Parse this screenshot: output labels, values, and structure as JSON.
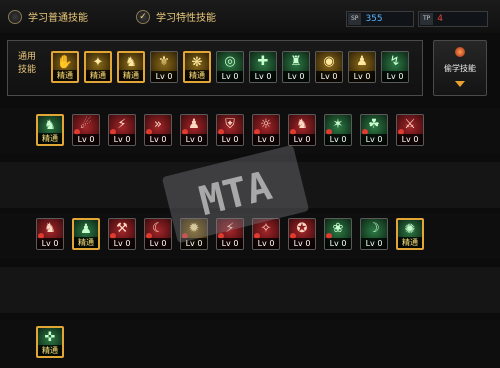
{
  "topbar": {
    "option_normal": "学习普通技能",
    "option_trait": "学习特性技能",
    "sp_label": "SP",
    "sp_value": "355",
    "tp_label": "TP",
    "tp_value": "4"
  },
  "common": {
    "label": "通用技能",
    "icons": [
      {
        "caption": "精通",
        "color": "gold",
        "hl": true,
        "glyph": "✋",
        "icon": "hand-icon"
      },
      {
        "caption": "精通",
        "color": "gold",
        "hl": true,
        "glyph": "✦",
        "icon": "swirl-icon"
      },
      {
        "caption": "精通",
        "color": "gold",
        "hl": true,
        "glyph": "♞",
        "icon": "figure-icon"
      },
      {
        "caption": "Lv 0",
        "color": "gold",
        "hl": false,
        "glyph": "⚜",
        "icon": "emblem-icon"
      },
      {
        "caption": "精通",
        "color": "gold",
        "hl": true,
        "glyph": "❋",
        "icon": "wing-icon"
      },
      {
        "caption": "Lv 0",
        "color": "green",
        "hl": false,
        "glyph": "◎",
        "icon": "target-icon"
      },
      {
        "caption": "Lv 0",
        "color": "green",
        "hl": false,
        "glyph": "✚",
        "icon": "cross-icon"
      },
      {
        "caption": "Lv 0",
        "color": "green",
        "hl": false,
        "glyph": "♜",
        "icon": "charge-icon"
      },
      {
        "caption": "Lv 0",
        "color": "gold",
        "hl": false,
        "glyph": "◉",
        "icon": "shield-icon"
      },
      {
        "caption": "Lv 0",
        "color": "gold",
        "hl": false,
        "glyph": "♟",
        "icon": "warrior-icon"
      },
      {
        "caption": "Lv 0",
        "color": "green",
        "hl": false,
        "glyph": "↯",
        "icon": "dash-icon"
      }
    ]
  },
  "steal_button": {
    "label": "偷学技能"
  },
  "row1": [
    {
      "caption": "精通",
      "color": "green",
      "hl": true,
      "glyph": "♞",
      "gem": false,
      "icon": "runner-icon"
    },
    {
      "caption": "Lv 0",
      "color": "red",
      "hl": false,
      "glyph": "☄",
      "gem": true,
      "icon": "slash-icon"
    },
    {
      "caption": "Lv 0",
      "color": "red",
      "hl": false,
      "glyph": "⚡",
      "gem": true,
      "icon": "claw-icon"
    },
    {
      "caption": "Lv 0",
      "color": "red",
      "hl": false,
      "glyph": "»",
      "gem": true,
      "icon": "arrows-icon"
    },
    {
      "caption": "Lv 0",
      "color": "red",
      "hl": false,
      "glyph": "♟",
      "gem": true,
      "icon": "kick-icon"
    },
    {
      "caption": "Lv 0",
      "color": "red",
      "hl": false,
      "glyph": "⛨",
      "gem": true,
      "icon": "guard-icon"
    },
    {
      "caption": "Lv 0",
      "color": "red",
      "hl": false,
      "glyph": "☼",
      "gem": true,
      "icon": "burst-icon"
    },
    {
      "caption": "Lv 0",
      "color": "red",
      "hl": false,
      "glyph": "♞",
      "gem": true,
      "icon": "strike-icon"
    },
    {
      "caption": "Lv 0",
      "color": "green",
      "hl": false,
      "glyph": "✶",
      "gem": true,
      "icon": "spark-icon"
    },
    {
      "caption": "Lv 0",
      "color": "green",
      "hl": false,
      "glyph": "☘",
      "gem": true,
      "icon": "leaf-icon"
    },
    {
      "caption": "Lv 0",
      "color": "red",
      "hl": false,
      "glyph": "⚔",
      "gem": true,
      "icon": "sword-icon"
    }
  ],
  "row2": [
    {
      "caption": "Lv 0",
      "color": "red",
      "hl": false,
      "glyph": "♞",
      "gem": true,
      "icon": "flag-icon"
    },
    {
      "caption": "精通",
      "color": "green",
      "hl": true,
      "glyph": "♟",
      "gem": false,
      "icon": "fighter-icon"
    },
    {
      "caption": "Lv 0",
      "color": "red",
      "hl": false,
      "glyph": "⚒",
      "gem": true,
      "icon": "pillar-icon"
    },
    {
      "caption": "Lv 0",
      "color": "red",
      "hl": false,
      "glyph": "☾",
      "gem": true,
      "icon": "crescent-icon"
    },
    {
      "caption": "Lv 0",
      "color": "gold",
      "hl": false,
      "glyph": "✹",
      "gem": true,
      "icon": "flare-icon"
    },
    {
      "caption": "Lv 0",
      "color": "red",
      "hl": false,
      "glyph": "⚡",
      "gem": true,
      "icon": "lightning-icon"
    },
    {
      "caption": "Lv 0",
      "color": "red",
      "hl": false,
      "glyph": "✧",
      "gem": true,
      "icon": "blade-icon"
    },
    {
      "caption": "Lv 0",
      "color": "red",
      "hl": false,
      "glyph": "✪",
      "gem": true,
      "icon": "star-icon"
    },
    {
      "caption": "Lv 0",
      "color": "green",
      "hl": false,
      "glyph": "❀",
      "gem": true,
      "icon": "bloom-icon"
    },
    {
      "caption": "Lv 0",
      "color": "green",
      "hl": false,
      "glyph": "☽",
      "gem": false,
      "icon": "moon-icon"
    },
    {
      "caption": "精通",
      "color": "green",
      "hl": true,
      "glyph": "✺",
      "gem": false,
      "icon": "aura-icon"
    }
  ],
  "row3": [
    {
      "caption": "精通",
      "color": "green",
      "hl": true,
      "glyph": "✜",
      "gem": false,
      "icon": "rune-icon"
    }
  ],
  "watermark": "MTA"
}
